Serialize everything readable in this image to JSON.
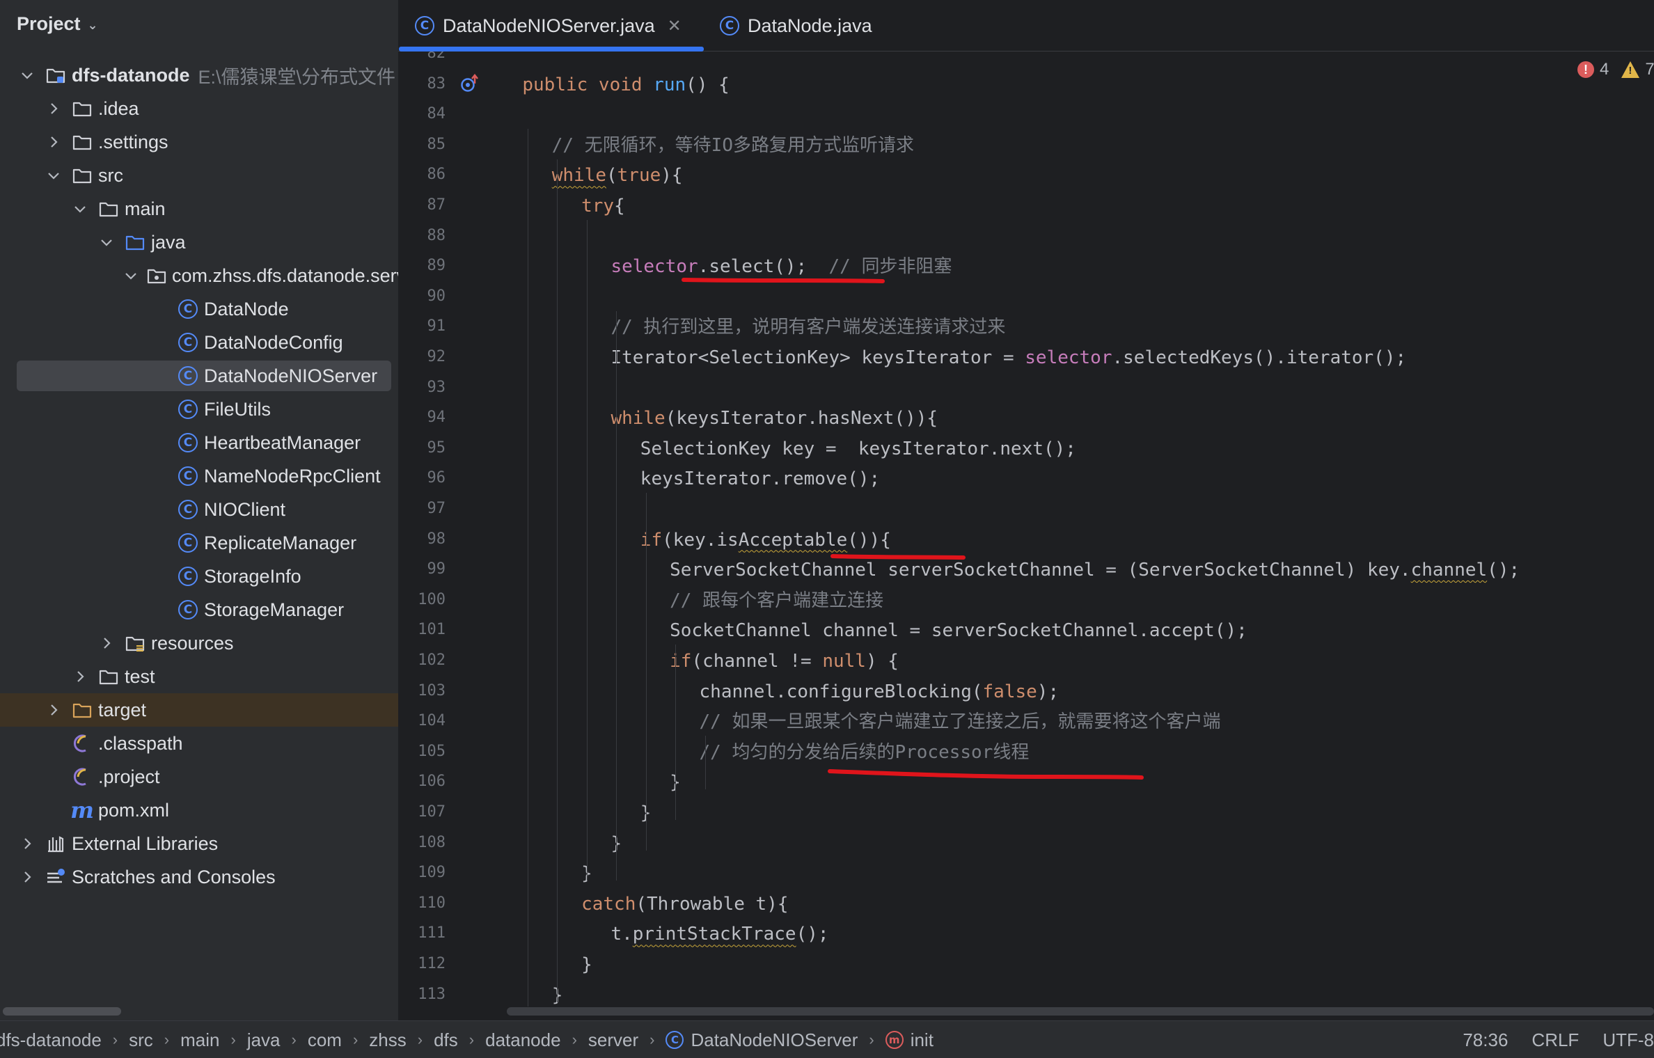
{
  "project_panel": {
    "title": "Project",
    "tree": [
      {
        "label": "dfs-datanode",
        "hint": "E:\\儒猿课堂\\分布式文件",
        "icon": "module-folder-icon",
        "indent": 0,
        "expanded": true,
        "bold": true
      },
      {
        "label": ".idea",
        "icon": "folder-icon",
        "indent": 1,
        "expanded": false
      },
      {
        "label": ".settings",
        "icon": "folder-icon",
        "indent": 1,
        "expanded": false
      },
      {
        "label": "src",
        "icon": "folder-icon",
        "indent": 1,
        "expanded": true
      },
      {
        "label": "main",
        "icon": "folder-icon",
        "indent": 2,
        "expanded": true
      },
      {
        "label": "java",
        "icon": "source-folder-icon",
        "indent": 3,
        "expanded": true
      },
      {
        "label": "com.zhss.dfs.datanode.server",
        "icon": "package-icon",
        "indent": 4,
        "expanded": true
      },
      {
        "label": "DataNode",
        "icon": "class-icon",
        "indent": 5
      },
      {
        "label": "DataNodeConfig",
        "icon": "class-icon",
        "indent": 5
      },
      {
        "label": "DataNodeNIOServer",
        "icon": "class-icon",
        "indent": 5,
        "selected": true
      },
      {
        "label": "FileUtils",
        "icon": "class-icon",
        "indent": 5
      },
      {
        "label": "HeartbeatManager",
        "icon": "class-icon",
        "indent": 5
      },
      {
        "label": "NameNodeRpcClient",
        "icon": "class-icon",
        "indent": 5
      },
      {
        "label": "NIOClient",
        "icon": "class-icon",
        "indent": 5
      },
      {
        "label": "ReplicateManager",
        "icon": "class-icon",
        "indent": 5
      },
      {
        "label": "StorageInfo",
        "icon": "class-icon",
        "indent": 5
      },
      {
        "label": "StorageManager",
        "icon": "class-icon",
        "indent": 5
      },
      {
        "label": "resources",
        "icon": "resources-folder-icon",
        "indent": 3,
        "expanded": false
      },
      {
        "label": "test",
        "icon": "folder-icon",
        "indent": 2,
        "expanded": false
      },
      {
        "label": "target",
        "icon": "excluded-folder-icon",
        "indent": 1,
        "expanded": false,
        "highlight": true
      },
      {
        "label": ".classpath",
        "icon": "eclipse-file-icon",
        "indent": 1
      },
      {
        "label": ".project",
        "icon": "eclipse-file-icon",
        "indent": 1
      },
      {
        "label": "pom.xml",
        "icon": "maven-icon",
        "indent": 1
      },
      {
        "label": "External Libraries",
        "icon": "library-icon",
        "indent": 0,
        "expanded": false
      },
      {
        "label": "Scratches and Consoles",
        "icon": "scratches-icon",
        "indent": 0,
        "expanded": false
      }
    ]
  },
  "tabs": [
    {
      "label": "DataNodeNIOServer.java",
      "active": true,
      "closable": true
    },
    {
      "label": "DataNode.java",
      "active": false,
      "closable": false
    }
  ],
  "inspection": {
    "errors": "4",
    "warnings": "7"
  },
  "code_lines": [
    {
      "n": "82",
      "indent": 0,
      "tokens": []
    },
    {
      "n": "83",
      "indent": 1,
      "tokens": [
        {
          "t": "public void ",
          "c": "kw"
        },
        {
          "t": "run",
          "c": "fn"
        },
        {
          "t": "() {"
        }
      ]
    },
    {
      "n": "84",
      "indent": 0,
      "tokens": []
    },
    {
      "n": "85",
      "indent": 2,
      "tokens": [
        {
          "t": "// 无限循环，等待IO多路复用方式监听请求",
          "c": "cm"
        }
      ]
    },
    {
      "n": "86",
      "indent": 2,
      "tokens": [
        {
          "t": "while",
          "c": "kw wavy"
        },
        {
          "t": "("
        },
        {
          "t": "true",
          "c": "kw"
        },
        {
          "t": "){"
        }
      ]
    },
    {
      "n": "87",
      "indent": 3,
      "tokens": [
        {
          "t": "try",
          "c": "kw"
        },
        {
          "t": "{"
        }
      ]
    },
    {
      "n": "88",
      "indent": 0,
      "tokens": []
    },
    {
      "n": "89",
      "indent": 4,
      "tokens": [
        {
          "t": "selector",
          "c": "fld"
        },
        {
          "t": ".select();  "
        },
        {
          "t": "// 同步非阻塞",
          "c": "cm"
        }
      ]
    },
    {
      "n": "90",
      "indent": 0,
      "tokens": []
    },
    {
      "n": "91",
      "indent": 4,
      "tokens": [
        {
          "t": "// 执行到这里，说明有客户端发送连接请求过来",
          "c": "cm"
        }
      ]
    },
    {
      "n": "92",
      "indent": 4,
      "tokens": [
        {
          "t": "Iterator<SelectionKey> keysIterator = "
        },
        {
          "t": "selector",
          "c": "fld"
        },
        {
          "t": ".selectedKeys().iterator();"
        }
      ]
    },
    {
      "n": "93",
      "indent": 0,
      "tokens": []
    },
    {
      "n": "94",
      "indent": 4,
      "tokens": [
        {
          "t": "while",
          "c": "kw"
        },
        {
          "t": "(keysIterator.hasNext()){"
        }
      ]
    },
    {
      "n": "95",
      "indent": 5,
      "tokens": [
        {
          "t": "SelectionKey key =  keysIterator.next();"
        }
      ]
    },
    {
      "n": "96",
      "indent": 5,
      "tokens": [
        {
          "t": "keysIterator.remove();"
        }
      ]
    },
    {
      "n": "97",
      "indent": 0,
      "tokens": []
    },
    {
      "n": "98",
      "indent": 5,
      "tokens": [
        {
          "t": "if",
          "c": "kw"
        },
        {
          "t": "(key.is"
        },
        {
          "t": "Acceptable",
          "c": "wavy"
        },
        {
          "t": "()){"
        }
      ]
    },
    {
      "n": "99",
      "indent": 6,
      "tokens": [
        {
          "t": "ServerSocketChannel serverSocketChannel = (ServerSocketChannel) key."
        },
        {
          "t": "channel",
          "c": "wavy"
        },
        {
          "t": "();"
        }
      ]
    },
    {
      "n": "100",
      "indent": 6,
      "tokens": [
        {
          "t": "// 跟每个客户端建立连接",
          "c": "cm"
        }
      ]
    },
    {
      "n": "101",
      "indent": 6,
      "tokens": [
        {
          "t": "SocketChannel channel = serverSocketChannel.accept();"
        }
      ]
    },
    {
      "n": "102",
      "indent": 6,
      "tokens": [
        {
          "t": "if",
          "c": "kw"
        },
        {
          "t": "(channel != "
        },
        {
          "t": "null",
          "c": "kw"
        },
        {
          "t": ") {"
        }
      ]
    },
    {
      "n": "103",
      "indent": 7,
      "tokens": [
        {
          "t": "channel.configureBlocking("
        },
        {
          "t": "false",
          "c": "kw"
        },
        {
          "t": ");"
        }
      ]
    },
    {
      "n": "104",
      "indent": 7,
      "tokens": [
        {
          "t": "// 如果一旦跟某个客户端建立了连接之后，就需要将这个客户端",
          "c": "cm"
        }
      ]
    },
    {
      "n": "105",
      "indent": 7,
      "tokens": [
        {
          "t": "// 均匀的分发给后续的Processor线程",
          "c": "cm"
        }
      ]
    },
    {
      "n": "106",
      "indent": 6,
      "tokens": [
        {
          "t": "}"
        }
      ]
    },
    {
      "n": "107",
      "indent": 5,
      "tokens": [
        {
          "t": "}"
        }
      ]
    },
    {
      "n": "108",
      "indent": 4,
      "tokens": [
        {
          "t": "}"
        }
      ]
    },
    {
      "n": "109",
      "indent": 3,
      "tokens": [
        {
          "t": "}"
        }
      ]
    },
    {
      "n": "110",
      "indent": 3,
      "tokens": [
        {
          "t": "catch",
          "c": "kw"
        },
        {
          "t": "(Throwable t){"
        }
      ]
    },
    {
      "n": "111",
      "indent": 4,
      "tokens": [
        {
          "t": "t."
        },
        {
          "t": "printStackTrace",
          "c": "wavy"
        },
        {
          "t": "();"
        }
      ]
    },
    {
      "n": "112",
      "indent": 3,
      "tokens": [
        {
          "t": "}"
        }
      ]
    },
    {
      "n": "113",
      "indent": 2,
      "tokens": [
        {
          "t": "}"
        }
      ]
    }
  ],
  "status_bar": {
    "breadcrumb": [
      "dfs-datanode",
      "src",
      "main",
      "java",
      "com",
      "zhss",
      "dfs",
      "datanode",
      "server",
      "DataNodeNIOServer",
      "init"
    ],
    "caret_position": "78:36",
    "line_separator": "CRLF",
    "encoding": "UTF-8"
  },
  "colors": {
    "keyword": "#cf8e6d",
    "function": "#56a8f5",
    "field": "#c77dbb",
    "comment": "#7a7e85",
    "accent": "#3574f0",
    "annotation_red": "#e0141b"
  }
}
